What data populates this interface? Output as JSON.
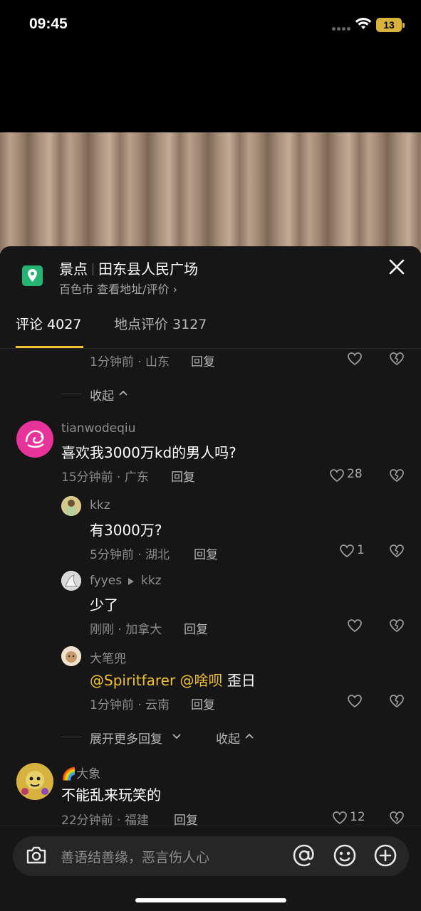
{
  "status_bar": {
    "time": "09:45",
    "battery": "13"
  },
  "location": {
    "category": "景点",
    "name": "田东县人民广场",
    "city": "百色市",
    "link_text": "查看地址/评价 ›"
  },
  "tabs": [
    {
      "label": "评论 4027",
      "active": true
    },
    {
      "label": "地点评价 3127",
      "active": false
    }
  ],
  "comments": {
    "partial_reply": {
      "meta": "1分钟前 · 山东",
      "reply": "回复"
    },
    "collapse_top": "收起",
    "c1": {
      "username": "tianwodeqiu",
      "text": "喜欢我3000万kd的男人吗?",
      "meta": "15分钟前 · 广东",
      "reply": "回复",
      "likes": "28"
    },
    "r1": {
      "username": "kkz",
      "text": "有3000万?",
      "meta": "5分钟前 · 湖北",
      "reply": "回复",
      "likes": "1"
    },
    "r2": {
      "username": "fyyes",
      "reply_to": "kkz",
      "text": "少了",
      "meta": "刚刚 · 加拿大",
      "reply": "回复"
    },
    "r3": {
      "username": "大笔兜",
      "mention1": "@Spiritfarer",
      "mention2": "@啥呗",
      "text": "歪日",
      "meta": "1分钟前 · 云南",
      "reply": "回复"
    },
    "expand_more": "展开更多回复",
    "collapse_mid": "收起",
    "c2": {
      "username_prefix": "🌈",
      "username": "大象",
      "text": "不能乱来玩笑的",
      "meta": "22分钟前 · 福建",
      "reply": "回复",
      "likes": "12"
    }
  },
  "input": {
    "placeholder": "善语结善缘，恶言伤人心"
  },
  "colors": {
    "accent": "#f2c230",
    "background": "#161616",
    "location_icon": "#22b573"
  }
}
